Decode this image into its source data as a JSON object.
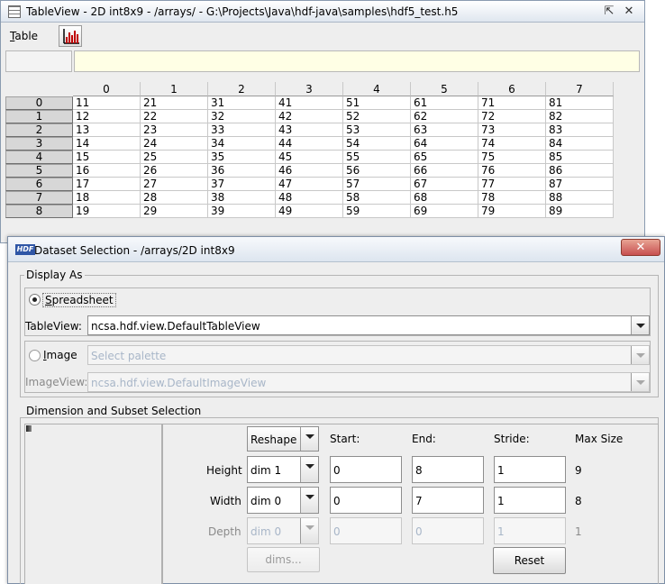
{
  "tableview": {
    "title": "TableView  -  2D int8x9  -  /arrays/  -  G:\\Projects\\Java\\hdf-java\\samples\\hdf5_test.h5",
    "menu_table_u": "T",
    "menu_table_rest": "able",
    "columns": [
      "0",
      "1",
      "2",
      "3",
      "4",
      "5",
      "6",
      "7"
    ],
    "rows": [
      {
        "label": "0",
        "cells": [
          "11",
          "21",
          "31",
          "41",
          "51",
          "61",
          "71",
          "81"
        ]
      },
      {
        "label": "1",
        "cells": [
          "12",
          "22",
          "32",
          "42",
          "52",
          "62",
          "72",
          "82"
        ]
      },
      {
        "label": "2",
        "cells": [
          "13",
          "23",
          "33",
          "43",
          "53",
          "63",
          "73",
          "83"
        ]
      },
      {
        "label": "3",
        "cells": [
          "14",
          "24",
          "34",
          "44",
          "54",
          "64",
          "74",
          "84"
        ]
      },
      {
        "label": "4",
        "cells": [
          "15",
          "25",
          "35",
          "45",
          "55",
          "65",
          "75",
          "85"
        ]
      },
      {
        "label": "5",
        "cells": [
          "16",
          "26",
          "36",
          "46",
          "56",
          "66",
          "76",
          "86"
        ]
      },
      {
        "label": "6",
        "cells": [
          "17",
          "27",
          "37",
          "47",
          "57",
          "67",
          "77",
          "87"
        ]
      },
      {
        "label": "7",
        "cells": [
          "18",
          "28",
          "38",
          "48",
          "58",
          "68",
          "78",
          "88"
        ]
      },
      {
        "label": "8",
        "cells": [
          "19",
          "29",
          "39",
          "49",
          "59",
          "69",
          "79",
          "89"
        ]
      }
    ]
  },
  "dialog": {
    "icon_text": "HDF",
    "title": "Dataset Selection - /arrays/2D int8x9",
    "close_label": "✕",
    "display_as": {
      "label": "Display As",
      "spreadsheet_u": "S",
      "spreadsheet_rest": "preadsheet",
      "tableview_label": "TableView:",
      "tableview_value": "ncsa.hdf.view.DefaultTableView",
      "image_u": "I",
      "image_rest": "mage",
      "palette_placeholder": "Select palette",
      "imageview_label": "ImageView:",
      "imageview_value": "ncsa.hdf.view.DefaultImageView"
    },
    "subset": {
      "label": "Dimension and Subset Selection",
      "reshape_label": "Reshape",
      "header_start": "Start:",
      "header_end": "End:",
      "header_stride": "Stride:",
      "header_max": "Max Size",
      "rows": [
        {
          "label": "Height",
          "dim": "dim 1",
          "start": "0",
          "end": "8",
          "stride": "1",
          "max": "9"
        },
        {
          "label": "Width",
          "dim": "dim 0",
          "start": "0",
          "end": "7",
          "stride": "1",
          "max": "8"
        },
        {
          "label": "Depth",
          "dim": "dim 0",
          "start": "0",
          "end": "0",
          "stride": "1",
          "max": "1"
        }
      ],
      "dims_button": "dims...",
      "reset_button": "Reset"
    }
  },
  "colors": {
    "cell_value_bg": "#ffffe5",
    "row_header_bg": "#d7d7d7",
    "close_button": "#c75050",
    "hdf_icon": "#2f56a6"
  },
  "icons": {
    "tableview_app": "grid-icon",
    "chart_button": "bar-chart-icon",
    "dialog_app": "hdf-logo-icon"
  }
}
